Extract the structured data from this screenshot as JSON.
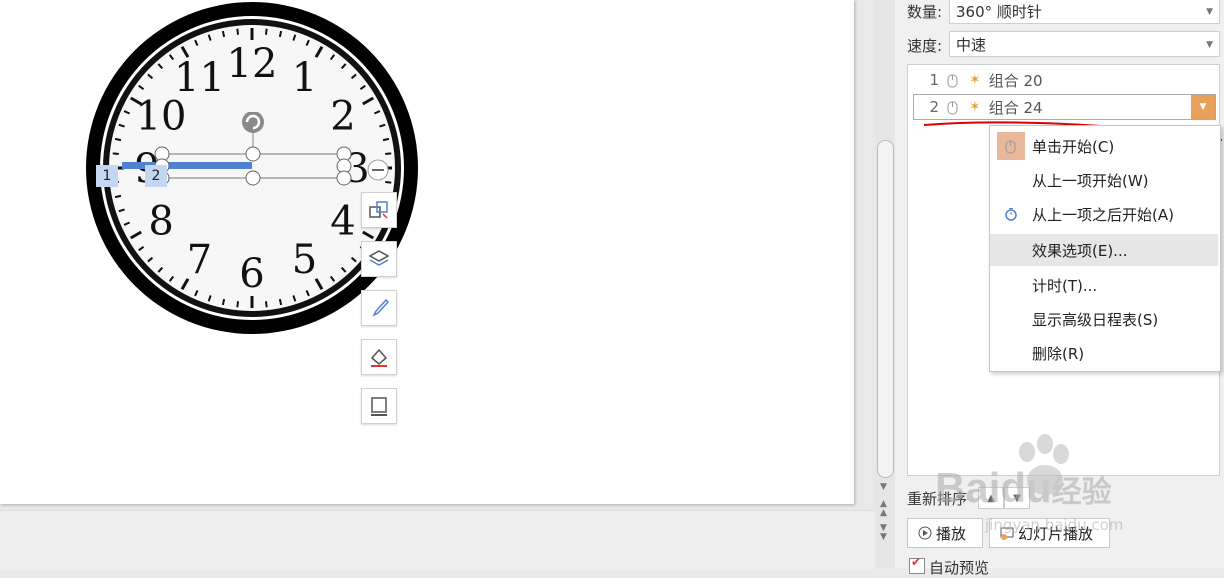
{
  "pane": {
    "quantity_label": "数量:",
    "quantity_value": "360° 顺时针",
    "speed_label": "速度:",
    "speed_value": "中速",
    "reorder_label": "重新排序",
    "play_button": "播放",
    "slideshow_button": "幻灯片播放",
    "autopreview_label": "自动预览"
  },
  "animations": [
    {
      "num": "1",
      "name": "组合 20"
    },
    {
      "num": "2",
      "name": "组合 24"
    }
  ],
  "context_menu": [
    {
      "label": "单击开始(C)",
      "icon": "mouse-click-icon"
    },
    {
      "label": "从上一项开始(W)",
      "icon": ""
    },
    {
      "label": "从上一项之后开始(A)",
      "icon": "clock-icon"
    },
    {
      "label": "效果选项(E)...",
      "icon": ""
    },
    {
      "label": "计时(T)...",
      "icon": ""
    },
    {
      "label": "显示高级日程表(S)",
      "icon": ""
    },
    {
      "label": "删除(R)",
      "icon": ""
    }
  ],
  "clock": {
    "numerals": [
      "12",
      "1",
      "2",
      "3",
      "4",
      "5",
      "6",
      "7",
      "8",
      "9",
      "10",
      "11"
    ]
  },
  "selection_tags": [
    "1",
    "2"
  ],
  "watermark": {
    "brand": "Baidu",
    "suffix": "经验",
    "sub": "jingyan.baidu.com"
  },
  "colors": {
    "accent": "#e8a05a",
    "selection_fill": "#4f82d1",
    "annotation_red": "#e00000",
    "tag_bg": "#c4d7f2"
  }
}
